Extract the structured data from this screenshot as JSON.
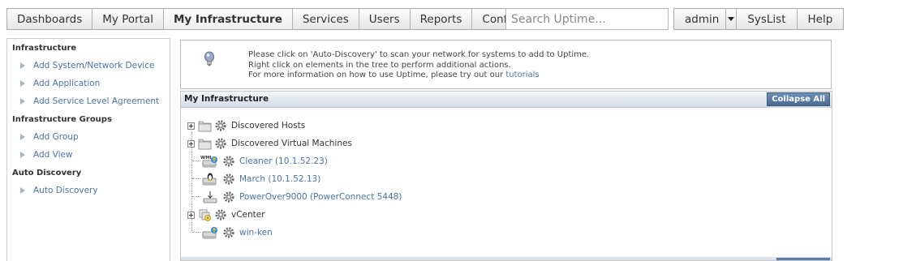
{
  "nav": {
    "items": [
      {
        "label": "Dashboards"
      },
      {
        "label": "My Portal"
      },
      {
        "label": "My Infrastructure",
        "active": true
      },
      {
        "label": "Services"
      },
      {
        "label": "Users"
      },
      {
        "label": "Reports"
      },
      {
        "label": "Config"
      }
    ],
    "search_placeholder": "Search Uptime...",
    "right": {
      "admin": "admin",
      "syslist": "SysList",
      "help": "Help"
    }
  },
  "sidebar": {
    "sections": [
      {
        "title": "Infrastructure",
        "links": [
          "Add System/Network Device",
          "Add Application",
          "Add Service Level Agreement"
        ]
      },
      {
        "title": "Infrastructure Groups",
        "links": [
          "Add Group",
          "Add View"
        ]
      },
      {
        "title": "Auto Discovery",
        "links": [
          "Auto Discovery"
        ]
      }
    ]
  },
  "info": {
    "line1": "Please click on 'Auto-Discovery' to scan your network for systems to add to Uptime.",
    "line2": "Right click on elements in the tree to perform additional actions.",
    "line3_prefix": "For more information on how to use Uptime, please try out our ",
    "line3_link": "tutorials",
    "icon": "lightbulb-icon"
  },
  "panel": {
    "title": "My Infrastructure",
    "collapse_label": "Collapse All",
    "tree": [
      {
        "label": "Discovered Hosts",
        "type": "folder",
        "expandable": true,
        "link": false
      },
      {
        "label": "Discovered Virtual Machines",
        "type": "folder",
        "expandable": true,
        "link": false
      },
      {
        "label": "Cleaner (10.1.52.23)",
        "type": "wmi-host",
        "expandable": false,
        "link": true
      },
      {
        "label": "March (10.1.52.13)",
        "type": "linux-host",
        "expandable": false,
        "link": true
      },
      {
        "label": "PowerOver9000 (PowerConnect 5448)",
        "type": "network-device",
        "expandable": false,
        "link": true
      },
      {
        "label": "vCenter",
        "type": "vcenter",
        "expandable": true,
        "link": false
      },
      {
        "label": "win-ken",
        "type": "windows-host",
        "expandable": false,
        "link": true
      }
    ]
  },
  "colors": {
    "link": "#4a74a6",
    "accent": "#4a6a94"
  }
}
